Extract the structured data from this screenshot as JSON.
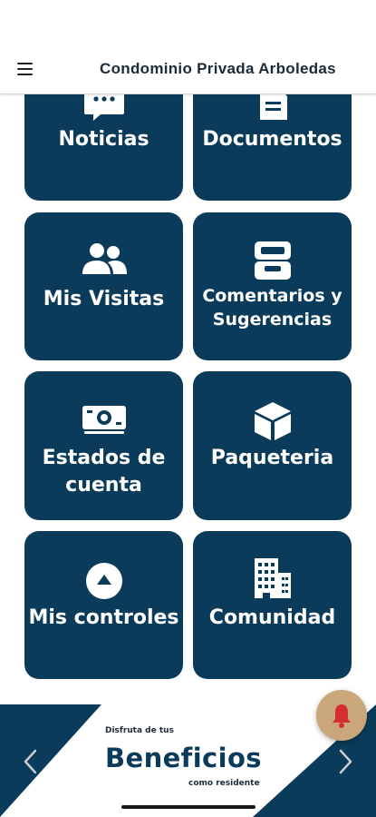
{
  "header": {
    "title": "Condominio Privada Arboledas"
  },
  "tiles": [
    {
      "label": "Noticias",
      "icon": "chat-bubble-icon"
    },
    {
      "label": "Documentos",
      "icon": "document-icon"
    },
    {
      "label": "Mis Visitas",
      "icon": "users-icon"
    },
    {
      "label_line1": "Comentarios y",
      "label_line2": "Sugerencias",
      "icon": "inbox-tray-icon"
    },
    {
      "label_line1": "Estados de",
      "label_line2": "cuenta",
      "icon": "money-bill-icon"
    },
    {
      "label": "Paqueteria",
      "icon": "package-box-icon"
    },
    {
      "label": "Mis controles",
      "icon": "up-arrow-circle-icon"
    },
    {
      "label": "Comunidad",
      "icon": "buildings-icon"
    }
  ],
  "banner": {
    "top_text": "Disfruta de tus",
    "title": "Beneficios",
    "subtitle": "como residente"
  },
  "colors": {
    "tile_background": "#0b3b5a",
    "fab_background": "#c9a77a",
    "bell_icon": "#d32f2f"
  }
}
